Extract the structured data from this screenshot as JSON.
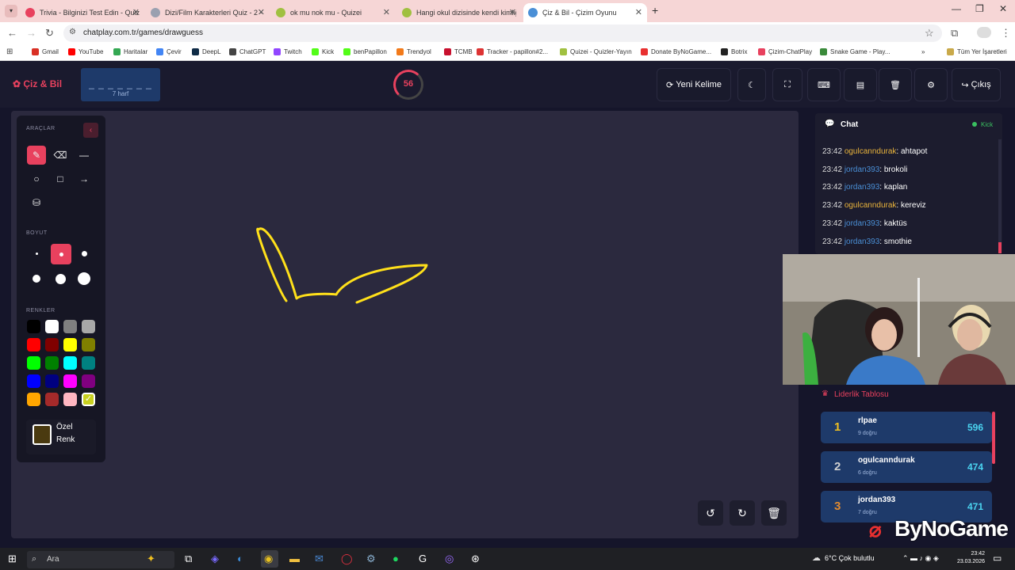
{
  "browser": {
    "tabs": [
      {
        "title": "Trivia - Bilginizi Test Edin - Quiz",
        "fav_color": "#e8415e",
        "active": false
      },
      {
        "title": "Dizi/Film Karakterleri Quiz - 2 - ",
        "fav_color": "#9aa0b0",
        "active": false
      },
      {
        "title": "ok mu nok mu - Quizei",
        "fav_color": "#a0c040",
        "active": false
      },
      {
        "title": "Hangi okul dizisinde kendi kimliğ",
        "fav_color": "#a0c040",
        "active": false
      },
      {
        "title": "Çiz & Bil - Çizim Oyunu",
        "fav_color": "#4a8fd6",
        "active": true
      }
    ],
    "tab_list_icon": "chevron-down-icon",
    "new_tab_icon": "plus-icon",
    "window_controls": {
      "minimize": "—",
      "restore": "❐",
      "close": "✕"
    },
    "url": "chatplay.com.tr/games/drawguess",
    "bookmarks": [
      {
        "label": "Gmail",
        "color": "#d93025"
      },
      {
        "label": "YouTube",
        "color": "#ff0000"
      },
      {
        "label": "Haritalar",
        "color": "#34a853"
      },
      {
        "label": "Çevir",
        "color": "#4285f4"
      },
      {
        "label": "DeepL",
        "color": "#0f2b46"
      },
      {
        "label": "ChatGPT",
        "color": "#444444"
      },
      {
        "label": "Twitch",
        "color": "#9146ff"
      },
      {
        "label": "Kick",
        "color": "#53fc18"
      },
      {
        "label": "benPapillon",
        "color": "#53fc18"
      },
      {
        "label": "Trendyol",
        "color": "#f27a1a"
      },
      {
        "label": "TCMB",
        "color": "#c8102e"
      },
      {
        "label": "Tracker - papillon#2...",
        "color": "#d33"
      },
      {
        "label": "Quizei - Quizler-Yayın",
        "color": "#a0c040"
      },
      {
        "label": "Donate ByNoGame...",
        "color": "#e83030"
      },
      {
        "label": "Botrix",
        "color": "#222222"
      },
      {
        "label": "Çizim-ChatPlay",
        "color": "#e8415e"
      },
      {
        "label": "Snake Game - Play...",
        "color": "#3a8a3a"
      }
    ],
    "all_bookmarks": "Tüm Yer İşaretleri"
  },
  "app": {
    "logo": "Çiz & Bil",
    "word_mask": "_ _ _ _ _ _ _",
    "word_hint": "7 harf",
    "timer": "56",
    "timer_fraction": 0.75,
    "new_word": "Yeni Kelime",
    "exit": "Çıkış"
  },
  "tools": {
    "label_tools": "ARAÇLAR",
    "label_size": "BOYUT",
    "label_colors": "RENKLER",
    "custom_color_label": "Özel Renk",
    "custom_color": "#4a3a10",
    "selected_tool": "pen",
    "selected_size": 2,
    "selected_color": "#c8d020",
    "colors": [
      "#000000",
      "#ffffff",
      "#808080",
      "#a8a8a8",
      "#ff0000",
      "#800000",
      "#ffff00",
      "#808000",
      "#00ff00",
      "#008000",
      "#00ffff",
      "#008080",
      "#0000ff",
      "#000080",
      "#ff00ff",
      "#800080",
      "#ffa500",
      "#a52a2a",
      "#ffb6c1",
      "#c8d020"
    ]
  },
  "chat": {
    "title": "Chat",
    "platform": "Kick",
    "messages": [
      {
        "time": "23:42",
        "user": "ogulcanndurak",
        "color": "yellow",
        "text": "ahtapot"
      },
      {
        "time": "23:42",
        "user": "jordan393",
        "color": "blue",
        "text": "brokoli"
      },
      {
        "time": "23:42",
        "user": "jordan393",
        "color": "blue",
        "text": "kaplan"
      },
      {
        "time": "23:42",
        "user": "ogulcanndurak",
        "color": "yellow",
        "text": "kereviz"
      },
      {
        "time": "23:42",
        "user": "jordan393",
        "color": "blue",
        "text": "kaktüs"
      },
      {
        "time": "23:42",
        "user": "jordan393",
        "color": "blue",
        "text": "smothie"
      }
    ]
  },
  "leaderboard": {
    "title": "Liderlik Tablosu",
    "rows": [
      {
        "rank": "1",
        "name": "rlpae",
        "sub": "9 doğru",
        "score": "596",
        "rank_color": "#f0c020"
      },
      {
        "rank": "2",
        "name": "ogulcanndurak",
        "sub": "6 doğru",
        "score": "474",
        "rank_color": "#d0d0d0"
      },
      {
        "rank": "3",
        "name": "jordan393",
        "sub": "7 doğru",
        "score": "471",
        "rank_color": "#e08a30"
      }
    ]
  },
  "watermark": "ByNoGame",
  "taskbar": {
    "search": "Ara",
    "weather": "6°C  Çok bulutlu",
    "time": "23:42",
    "date": "23.03.2026"
  }
}
